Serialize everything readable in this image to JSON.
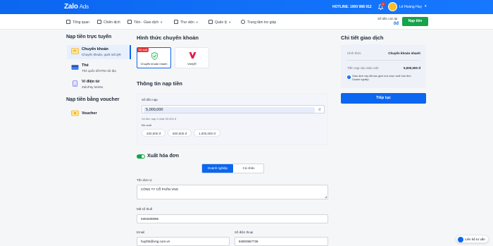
{
  "header": {
    "logo_main": "Zalo",
    "logo_sub": "Ads",
    "hotline": "HOTLINE: 1900 988 912",
    "notification_count": "1",
    "username": "Lê Hoàng Huy",
    "brand_color": "#0b66f0"
  },
  "nav": {
    "items": [
      {
        "label": "Tổng quan",
        "icon": "home-icon"
      },
      {
        "label": "Chiến dịch",
        "icon": "megaphone-icon"
      },
      {
        "label": "Tiền - Giao dịch",
        "icon": "wallet-icon"
      },
      {
        "label": "Thư viện",
        "icon": "folder-icon"
      },
      {
        "label": "Quản lý",
        "icon": "grid-icon"
      },
      {
        "label": "Trung tâm trợ giúp",
        "icon": "help-icon"
      }
    ],
    "balance_label": "Số tiền còn lại",
    "balance_value": "0đ",
    "topup_label": "Nạp tiền"
  },
  "sidebar": {
    "online_title": "Nạp tiền trực tuyến",
    "items": [
      {
        "title": "Chuyển khoản",
        "subtitle": "Chuyển khoản, quét mã QR",
        "icon": "bank-transfer-icon"
      },
      {
        "title": "Thẻ",
        "subtitle": "Thẻ quốc tế/ATM nội địa",
        "icon": "card-icon"
      },
      {
        "title": "Ví điện tử",
        "subtitle": "ZaloPay MoMo",
        "icon": "ewallet-icon"
      }
    ],
    "voucher_title": "Nạp tiền bằng voucher",
    "voucher_item": {
      "title": "Voucher",
      "icon": "voucher-icon"
    }
  },
  "main": {
    "method_title": "Hình thức chuyển khoản",
    "methods": [
      {
        "label": "Chuyển khoản nhanh",
        "tag": "Đề xuất",
        "icon": "fast-transfer-icon"
      },
      {
        "label": "VietQR",
        "tag": "",
        "icon": "vietqr-icon"
      }
    ],
    "topup_info_title": "Thông tin nạp tiền",
    "amount_label": "Số tiền nạp",
    "amount_value": "5,000,000",
    "currency": "đ",
    "min_note": "Số tiền nạp ít nhất 50,000 đ",
    "suggest_label": "Đề xuất",
    "suggestions": [
      "200,000 đ",
      "500,000 đ",
      "1,000,000 đ"
    ],
    "invoice_title": "Xuất hóa đơn",
    "invoice_toggle_on": true,
    "invoice_types": [
      "Doanh nghiệp",
      "Cá nhân"
    ],
    "unit_name_label": "Tên đơn vị",
    "unit_name_value": "CÔNG TY CỔ PHẦN VNG",
    "tax_code_label": "Mã số thuế",
    "tax_code_value": "0303490096",
    "email_label": "Email",
    "email_value": "huyth5@vng.com.vn",
    "phone_label": "Số điện thoại",
    "phone_value": "84903967736"
  },
  "detail": {
    "title": "Chi tiết giao dịch",
    "method_label": "Hình thức",
    "method_value": "Chuyển khoản nhanh",
    "amount_label": "Tiền nạp vào Zalo Ads",
    "amount_value": "5,000,000 đ",
    "note": "Giao dịch này đã bao gồm lựa chọn xuất hóa đơn Doanh nghiệp",
    "continue_label": "Tiếp tục"
  },
  "consult": {
    "label": "Liên hệ tư vấn"
  }
}
